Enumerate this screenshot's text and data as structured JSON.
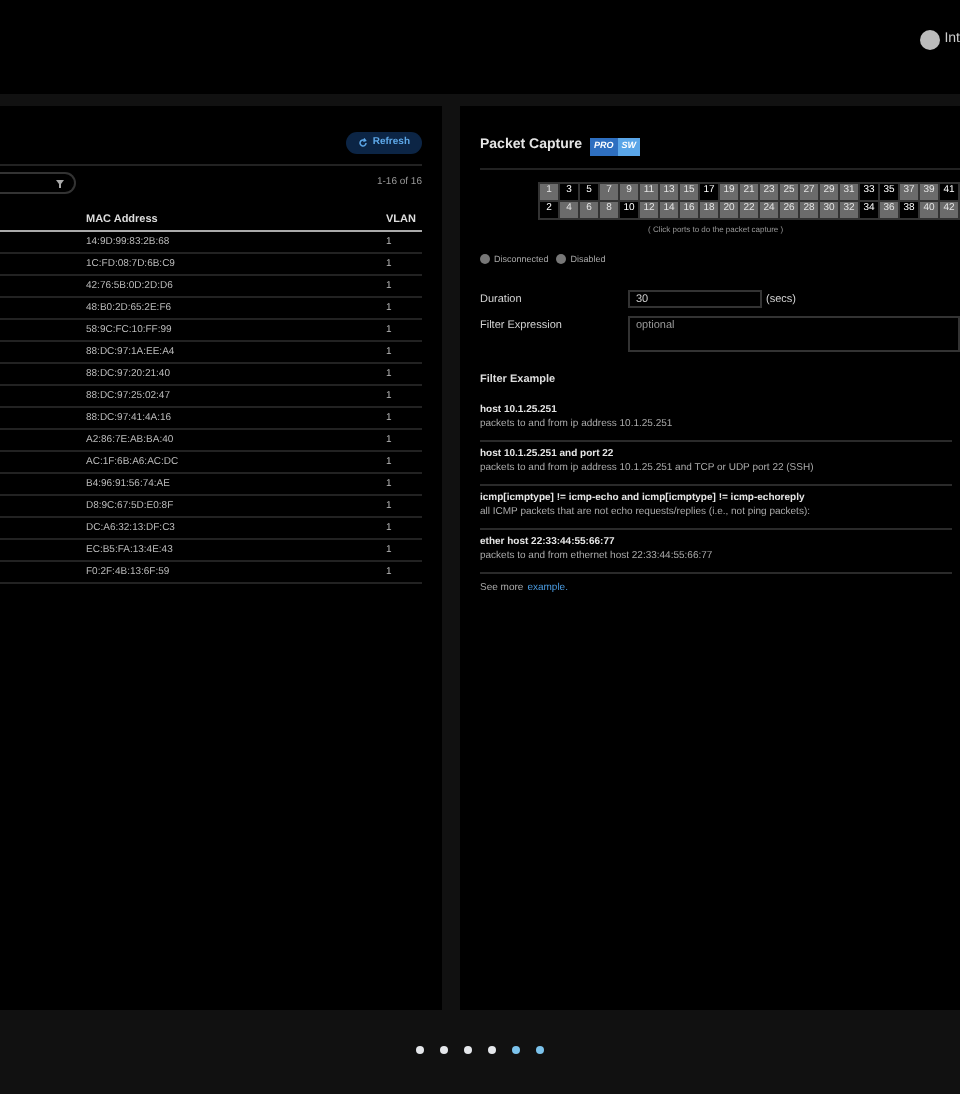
{
  "top_bar": {
    "label": "Int"
  },
  "left_panel": {
    "refresh_button": "Refresh",
    "count": "1-16 of 16",
    "columns": [
      "MAC Address",
      "VLAN"
    ],
    "rows": [
      [
        "14:9D:99:83:2B:68",
        "1"
      ],
      [
        "1C:FD:08:7D:6B:C9",
        "1"
      ],
      [
        "42:76:5B:0D:2D:D6",
        "1"
      ],
      [
        "48:B0:2D:65:2E:F6",
        "1"
      ],
      [
        "58:9C:FC:10:FF:99",
        "1"
      ],
      [
        "88:DC:97:1A:EE:A4",
        "1"
      ],
      [
        "88:DC:97:20:21:40",
        "1"
      ],
      [
        "88:DC:97:25:02:47",
        "1"
      ],
      [
        "88:DC:97:41:4A:16",
        "1"
      ],
      [
        "A2:86:7E:AB:BA:40",
        "1"
      ],
      [
        "AC:1F:6B:A6:AC:DC",
        "1"
      ],
      [
        "B4:96:91:56:74:AE",
        "1"
      ],
      [
        "D8:9C:67:5D:E0:8F",
        "1"
      ],
      [
        "DC:A6:32:13:DF:C3",
        "1"
      ],
      [
        "EC:B5:FA:13:4E:43",
        "1"
      ],
      [
        "F0:2F:4B:13:6F:59",
        "1"
      ]
    ]
  },
  "packet_capture": {
    "title": "Packet Capture",
    "badge": [
      "PRO",
      "SW"
    ],
    "ports_top": [
      {
        "label": "1",
        "kind": "idle"
      },
      {
        "label": "3",
        "kind": "active"
      },
      {
        "label": "5",
        "kind": "active"
      },
      {
        "label": "7",
        "kind": "idle"
      },
      {
        "label": "9",
        "kind": "idle"
      },
      {
        "label": "11",
        "kind": "idle"
      },
      {
        "label": "13",
        "kind": "idle"
      },
      {
        "label": "15",
        "kind": "idle"
      },
      {
        "label": "17",
        "kind": "active"
      },
      {
        "label": "19",
        "kind": "idle"
      },
      {
        "label": "21",
        "kind": "idle"
      },
      {
        "label": "23",
        "kind": "idle"
      },
      {
        "label": "25",
        "kind": "idle"
      },
      {
        "label": "27",
        "kind": "idle"
      },
      {
        "label": "29",
        "kind": "idle"
      },
      {
        "label": "31",
        "kind": "idle"
      },
      {
        "label": "33",
        "kind": "active"
      },
      {
        "label": "35",
        "kind": "active"
      },
      {
        "label": "37",
        "kind": "idle"
      },
      {
        "label": "39",
        "kind": "idle"
      },
      {
        "label": "41",
        "kind": "active"
      }
    ],
    "ports_bottom": [
      {
        "label": "2",
        "kind": "active"
      },
      {
        "label": "4",
        "kind": "idle"
      },
      {
        "label": "6",
        "kind": "idle"
      },
      {
        "label": "8",
        "kind": "idle"
      },
      {
        "label": "10",
        "kind": "active"
      },
      {
        "label": "12",
        "kind": "idle"
      },
      {
        "label": "14",
        "kind": "idle"
      },
      {
        "label": "16",
        "kind": "idle"
      },
      {
        "label": "18",
        "kind": "idle"
      },
      {
        "label": "20",
        "kind": "idle"
      },
      {
        "label": "22",
        "kind": "idle"
      },
      {
        "label": "24",
        "kind": "idle"
      },
      {
        "label": "26",
        "kind": "idle"
      },
      {
        "label": "28",
        "kind": "idle"
      },
      {
        "label": "30",
        "kind": "idle"
      },
      {
        "label": "32",
        "kind": "idle"
      },
      {
        "label": "34",
        "kind": "active"
      },
      {
        "label": "36",
        "kind": "idle"
      },
      {
        "label": "38",
        "kind": "active"
      },
      {
        "label": "40",
        "kind": "idle"
      },
      {
        "label": "42",
        "kind": "idle"
      }
    ],
    "ports_hint": "( Click ports to do the packet capture )",
    "legend": [
      "Disconnected",
      "Disabled"
    ],
    "duration": {
      "label": "Duration",
      "value": "30",
      "unit": "(secs)"
    },
    "filter_expression": {
      "label": "Filter Expression",
      "placeholder": "optional"
    },
    "filter_example_title": "Filter Example",
    "examples": [
      {
        "expression": "host 10.1.25.251",
        "description": "packets to and from ip address 10.1.25.251"
      },
      {
        "expression": "host 10.1.25.251 and port 22",
        "description": "packets to and from ip address 10.1.25.251 and TCP or UDP port 22 (SSH)"
      },
      {
        "expression": "icmp[icmptype] != icmp-echo and icmp[icmptype] != icmp-echoreply",
        "description": "all ICMP packets that are not echo requests/replies (i.e., not ping packets):"
      },
      {
        "expression": "ether host 22:33:44:55:66:77",
        "description": "packets to and from ethernet host 22:33:44:55:66:77"
      }
    ],
    "see_more": "See more",
    "see_more_link": "example."
  },
  "pager_dots": [
    {
      "color": "#e5e7eb"
    },
    {
      "color": "#e5e7eb"
    },
    {
      "color": "#e5e7eb"
    },
    {
      "color": "#e5e7eb"
    },
    {
      "color": "#7cc3ec"
    },
    {
      "color": "#7cc3ec"
    }
  ]
}
